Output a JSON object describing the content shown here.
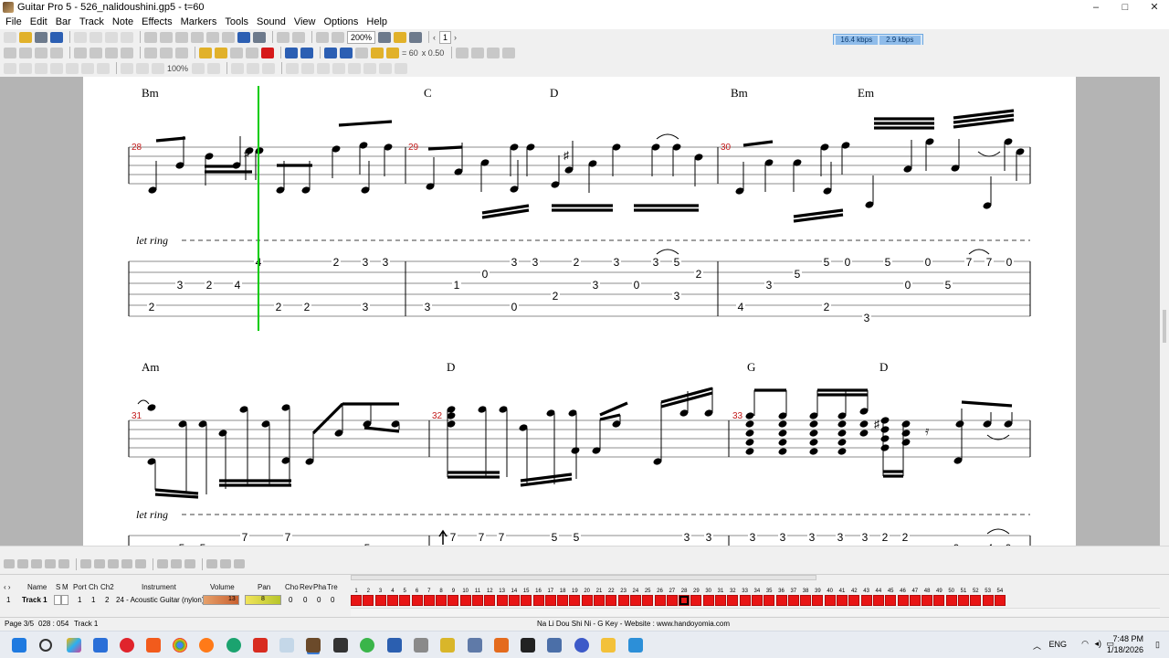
{
  "window": {
    "title": "Guitar Pro 5 - 526_nalidoushini.gp5 - t=60",
    "min": "–",
    "max": "□",
    "close": "✕"
  },
  "menu": [
    "File",
    "Edit",
    "Bar",
    "Track",
    "Note",
    "Effects",
    "Markers",
    "Tools",
    "Sound",
    "View",
    "Options",
    "Help"
  ],
  "toolbar": {
    "zoom": "200%",
    "page_number": "1",
    "tempo_label": "= 60",
    "speed": "x 0.50",
    "kbps_in": "16.4 kbps",
    "kbps_out": "2.9 kbps",
    "volume_pct": "100%"
  },
  "score": {
    "system1": {
      "bars": [
        "28",
        "29",
        "30"
      ],
      "chords": [
        "Bm",
        "C",
        "D",
        "Bm",
        "Em"
      ],
      "let_ring": "let ring",
      "tab": [
        [
          "2",
          "3",
          "2",
          "4",
          "4",
          "2",
          "2",
          "2",
          "3",
          "3"
        ],
        [
          "3",
          "3",
          "1",
          "0",
          "3",
          "3",
          "0",
          "2",
          "2",
          "3",
          "3",
          "0",
          "3",
          "5",
          "3"
        ],
        [
          "2",
          "4",
          "3",
          "5",
          "5",
          "2",
          "0",
          "3",
          "5",
          "0",
          "0",
          "5",
          "7",
          "7",
          "0"
        ]
      ]
    },
    "system2": {
      "bars": [
        "31",
        "32",
        "33"
      ],
      "chords": [
        "Am",
        "D",
        "G",
        "D"
      ],
      "let_ring": "let ring",
      "tab": [
        "5",
        "5",
        "7",
        "7",
        "5",
        "7",
        "7",
        "7",
        "5",
        "5",
        "3",
        "3",
        "3",
        "3",
        "3",
        "3",
        "3",
        "2",
        "2",
        "0",
        "4",
        "0"
      ]
    }
  },
  "tracks": {
    "headers": [
      "Name",
      "S",
      "M",
      "Port",
      "Ch",
      "Ch2",
      "Instrument",
      "Volume",
      "Pan",
      "Cho",
      "Rev",
      "Pha",
      "Tre"
    ],
    "rows": [
      {
        "number": "1",
        "name": "Track 1",
        "port": "1",
        "ch": "1",
        "ch2": "2",
        "instrument": "24 - Acoustic Guitar (nylon)",
        "volume_value": "13",
        "pan_value": "8",
        "cho": "0",
        "rev": "0",
        "pha": "0",
        "tre": "0"
      }
    ],
    "bar_count": 54,
    "cursor_bar": 28
  },
  "status": {
    "page": "Page 3/5",
    "position": "028 : 054",
    "track": "Track 1",
    "song_info": "Na Li Dou Shi Ni - G Key - Website : www.handoyomia.com"
  },
  "taskbar": {
    "lang": "ENG",
    "time": "7:48 PM",
    "date": "1/18/2026"
  },
  "colors": {
    "cursor": "#00cc00",
    "bar_number": "#c21a1a",
    "bar_cell": "#e81515"
  }
}
